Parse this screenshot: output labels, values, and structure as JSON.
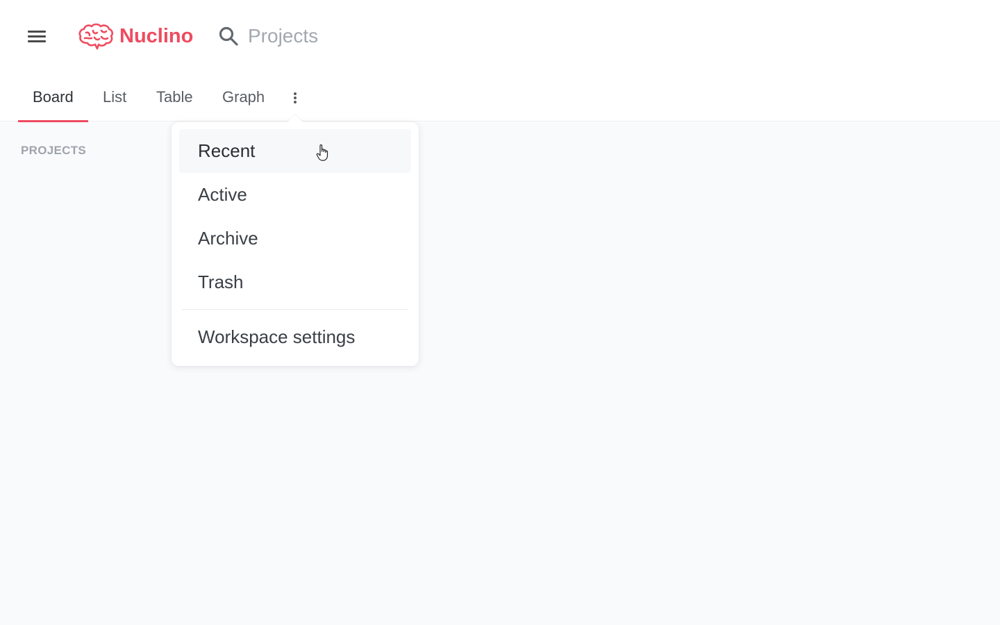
{
  "app": {
    "brand": "Nuclino",
    "brand_color": "#ef4b5f"
  },
  "header": {
    "menu_icon": "hamburger-icon",
    "logo_icon": "brain-icon",
    "search_icon": "search-icon",
    "search_text": "Projects"
  },
  "tabs": [
    {
      "label": "Board",
      "active": true
    },
    {
      "label": "List",
      "active": false
    },
    {
      "label": "Table",
      "active": false
    },
    {
      "label": "Graph",
      "active": false
    }
  ],
  "more_icon": "more-vertical-icon",
  "sidebar": {
    "section_label": "PROJECTS"
  },
  "dropdown": {
    "items": [
      {
        "label": "Recent",
        "hovered": true
      },
      {
        "label": "Active"
      },
      {
        "label": "Archive"
      },
      {
        "label": "Trash"
      }
    ],
    "footer_item": "Workspace settings"
  }
}
